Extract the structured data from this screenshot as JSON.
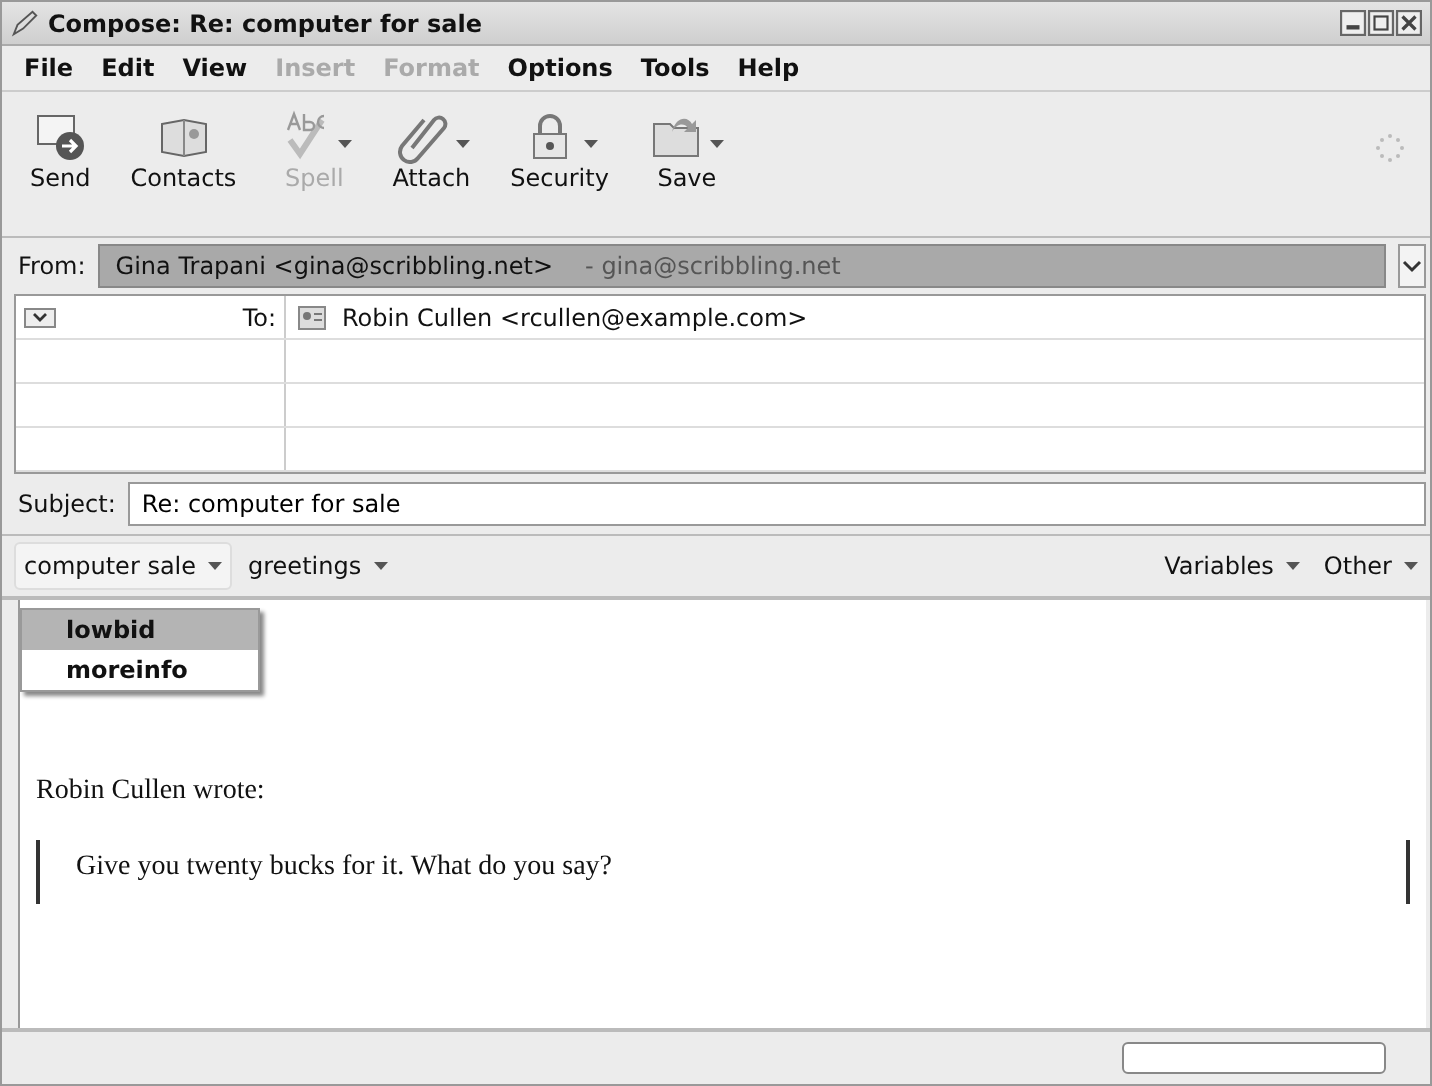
{
  "window": {
    "title": "Compose: Re: computer for sale"
  },
  "menu": [
    {
      "label": "File",
      "disabled": false
    },
    {
      "label": "Edit",
      "disabled": false
    },
    {
      "label": "View",
      "disabled": false
    },
    {
      "label": "Insert",
      "disabled": true
    },
    {
      "label": "Format",
      "disabled": true
    },
    {
      "label": "Options",
      "disabled": false
    },
    {
      "label": "Tools",
      "disabled": false
    },
    {
      "label": "Help",
      "disabled": false
    }
  ],
  "toolbar": [
    {
      "kind": "send",
      "label": "Send",
      "disabled": false,
      "dropdown": false
    },
    {
      "kind": "contacts",
      "label": "Contacts",
      "disabled": false,
      "dropdown": false
    },
    {
      "kind": "spell",
      "label": "Spell",
      "disabled": true,
      "dropdown": true
    },
    {
      "kind": "attach",
      "label": "Attach",
      "disabled": false,
      "dropdown": true
    },
    {
      "kind": "security",
      "label": "Security",
      "disabled": false,
      "dropdown": true
    },
    {
      "kind": "save",
      "label": "Save",
      "disabled": false,
      "dropdown": true
    }
  ],
  "from": {
    "label": "From:",
    "value": "Gina Trapani <gina@scribbling.net>",
    "account": "- gina@scribbling.net"
  },
  "recipients": [
    {
      "type": "To:",
      "address": "Robin Cullen <rcullen@example.com>"
    }
  ],
  "subject": {
    "label": "Subject:",
    "value": "Re: computer for sale"
  },
  "quicktext": {
    "left": [
      {
        "label": "computer sale",
        "open": true
      },
      {
        "label": "greetings",
        "open": false
      }
    ],
    "right": [
      {
        "label": "Variables"
      },
      {
        "label": "Other"
      }
    ],
    "menu": [
      {
        "label": "lowbid",
        "selected": true
      },
      {
        "label": "moreinfo",
        "selected": false
      }
    ]
  },
  "body": {
    "attribution": "Robin Cullen wrote:",
    "quote": "Give you twenty bucks for it.  What do you say?"
  }
}
